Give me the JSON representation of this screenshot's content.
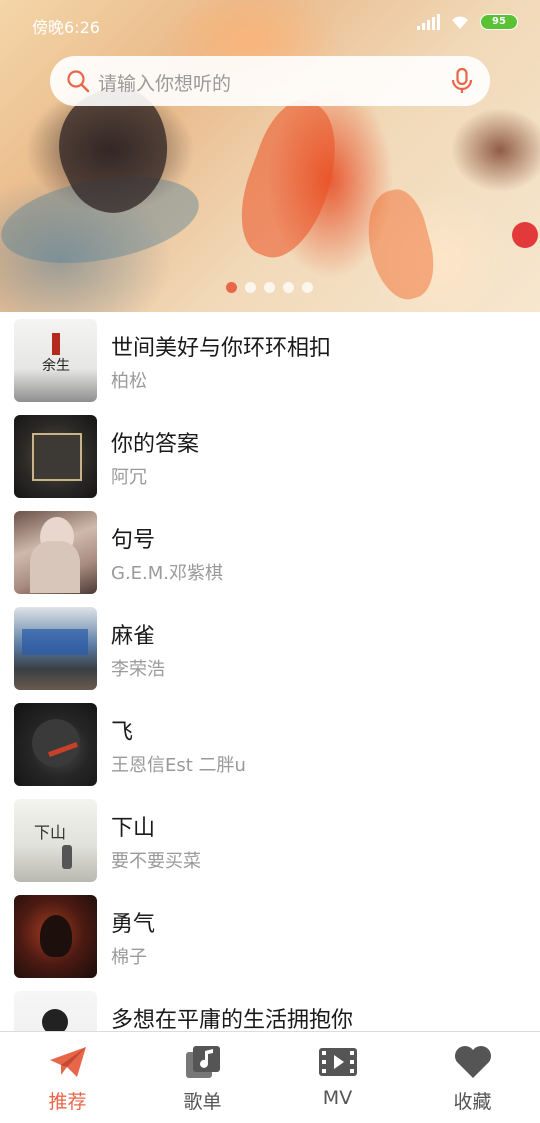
{
  "status_bar": {
    "time": "傍晚6:26",
    "battery": "95"
  },
  "search": {
    "placeholder": "请输入你想听的"
  },
  "banner": {
    "dots": 5,
    "active_dot": 0
  },
  "songs": [
    {
      "title": "世间美好与你环环相扣",
      "artist": "柏松"
    },
    {
      "title": "你的答案",
      "artist": "阿冗"
    },
    {
      "title": "句号",
      "artist": "G.E.M.邓紫棋"
    },
    {
      "title": "麻雀",
      "artist": "李荣浩"
    },
    {
      "title": "飞",
      "artist": "王恩信Est 二胖u"
    },
    {
      "title": "下山",
      "artist": "要不要买菜"
    },
    {
      "title": "勇气",
      "artist": "棉子"
    },
    {
      "title": "多想在平庸的生活拥抱你",
      "artist": ""
    }
  ],
  "nav": [
    {
      "label": "推荐",
      "icon": "paper-plane-icon",
      "active": true
    },
    {
      "label": "歌单",
      "icon": "music-note-icon",
      "active": false
    },
    {
      "label": "MV",
      "icon": "film-icon",
      "active": false
    },
    {
      "label": "收藏",
      "icon": "heart-icon",
      "active": false
    }
  ],
  "colors": {
    "accent": "#e8664a",
    "inactive": "#555555",
    "muted": "#9a9a9a"
  }
}
